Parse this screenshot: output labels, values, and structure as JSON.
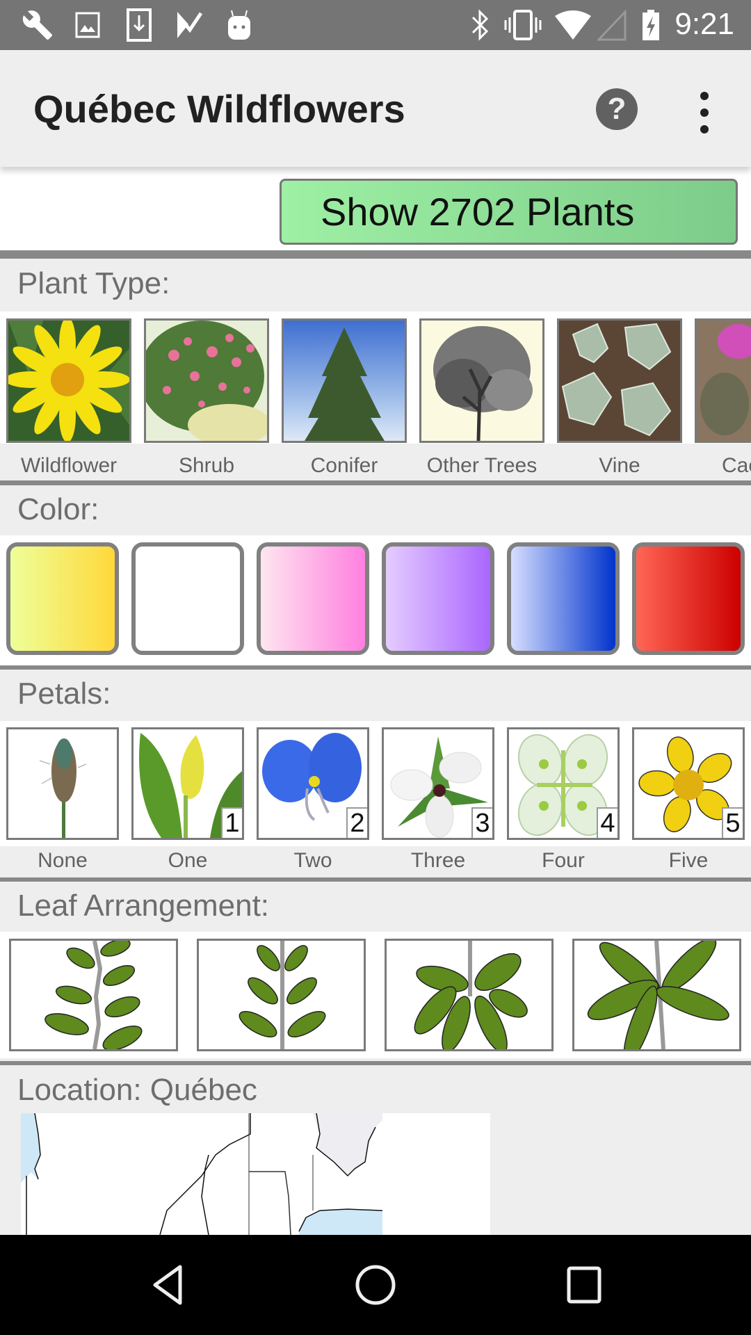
{
  "status_bar": {
    "left_icons": [
      "wrench-icon",
      "image-icon",
      "download-icon",
      "check-icon",
      "android-icon"
    ],
    "right_icons": [
      "bluetooth-icon",
      "vibrate-icon",
      "wifi-icon",
      "signal-icon",
      "battery-charging-icon"
    ],
    "time": "9:21"
  },
  "app_bar": {
    "title": "Québec Wildflowers",
    "help_label": "?",
    "more_icon": "more-vert-icon"
  },
  "show_button": {
    "label": "Show 2702 Plants"
  },
  "plant_type": {
    "label": "Plant Type:",
    "items": [
      {
        "label": "Wildflower",
        "image": "yellow-flower"
      },
      {
        "label": "Shrub",
        "image": "pink-shrub"
      },
      {
        "label": "Conifer",
        "image": "conifer-tree"
      },
      {
        "label": "Other Trees",
        "image": "deciduous-tree"
      },
      {
        "label": "Vine",
        "image": "ivy-vine"
      },
      {
        "label": "Cac",
        "image": "cactus"
      }
    ]
  },
  "color": {
    "label": "Color:",
    "swatches": [
      {
        "name": "yellow",
        "from": "#eeff99",
        "to": "#ffd83a"
      },
      {
        "name": "white",
        "from": "#ffffff",
        "to": "#ffffff"
      },
      {
        "name": "pink",
        "from": "#fde6ef",
        "to": "#ff7fe0"
      },
      {
        "name": "purple",
        "from": "#e4ccff",
        "to": "#aa66ff"
      },
      {
        "name": "blue",
        "from": "#d6deff",
        "to": "#0033cc"
      },
      {
        "name": "red",
        "from": "#ff6655",
        "to": "#cc0000"
      }
    ]
  },
  "petals": {
    "label": "Petals:",
    "items": [
      {
        "label": "None",
        "badge": ""
      },
      {
        "label": "One",
        "badge": "1"
      },
      {
        "label": "Two",
        "badge": "2"
      },
      {
        "label": "Three",
        "badge": "3"
      },
      {
        "label": "Four",
        "badge": "4"
      },
      {
        "label": "Five",
        "badge": "5"
      }
    ]
  },
  "leaf_arrangement": {
    "label": "Leaf Arrangement:",
    "items": [
      "alternate",
      "opposite",
      "whorled",
      "basal-whorl"
    ]
  },
  "location": {
    "label": "Location: Québec"
  },
  "nav_bar": {
    "buttons": [
      "back-icon",
      "home-icon",
      "recents-icon"
    ]
  }
}
